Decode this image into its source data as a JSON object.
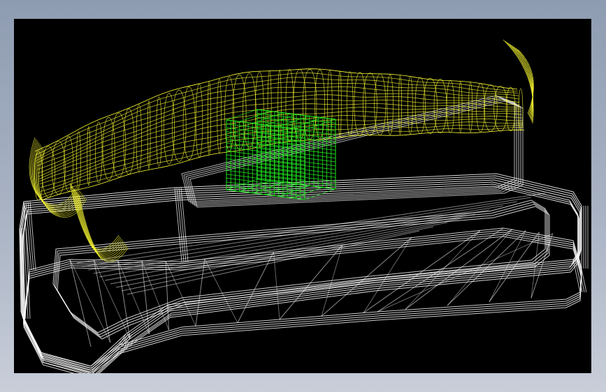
{
  "scene": {
    "background_color": "#000000",
    "frame_color": "#9aa6b8",
    "mesh_colors": {
      "base": "#ffffff",
      "handle": "#ffff33",
      "insert": "#22ee22"
    }
  }
}
